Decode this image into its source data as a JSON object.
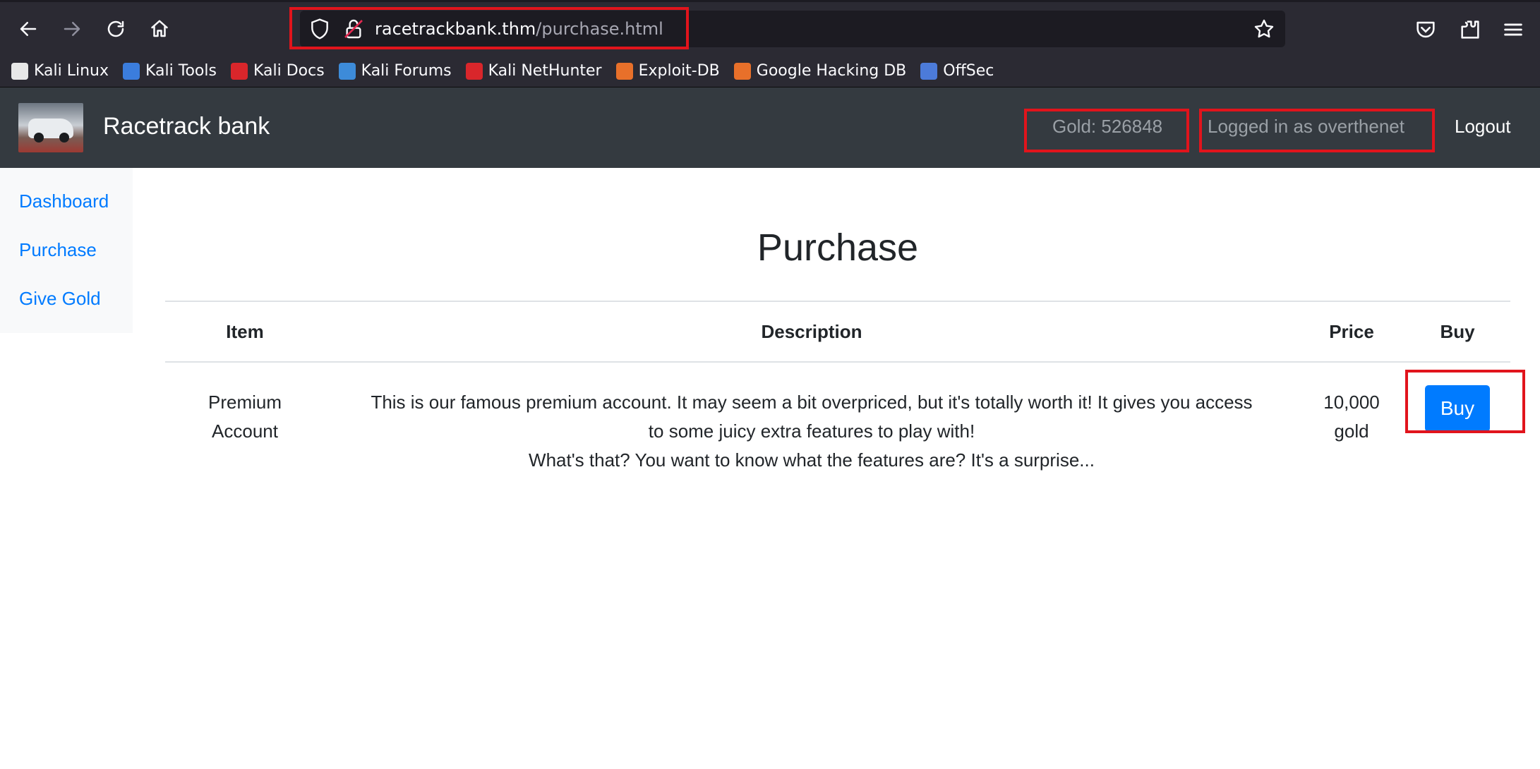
{
  "browser": {
    "url_host": "racetrackbank.thm",
    "url_path": "/purchase.html",
    "bookmarks": [
      {
        "label": "Kali Linux",
        "icon": "kali-dragon-icon",
        "color": "#e8e8e8"
      },
      {
        "label": "Kali Tools",
        "icon": "kali-tools-icon",
        "color": "#3b7ddd"
      },
      {
        "label": "Kali Docs",
        "icon": "kali-docs-icon",
        "color": "#d9262b"
      },
      {
        "label": "Kali Forums",
        "icon": "kali-forums-icon",
        "color": "#3d8bd9"
      },
      {
        "label": "Kali NetHunter",
        "icon": "kali-nethunter-icon",
        "color": "#d9262b"
      },
      {
        "label": "Exploit-DB",
        "icon": "exploit-db-icon",
        "color": "#e8702a"
      },
      {
        "label": "Google Hacking DB",
        "icon": "ghdb-icon",
        "color": "#e8702a"
      },
      {
        "label": "OffSec",
        "icon": "offsec-icon",
        "color": "#4c7bd9"
      }
    ]
  },
  "header": {
    "brand": "Racetrack bank",
    "gold": "Gold: 526848",
    "login": "Logged in as overthenet",
    "logout": "Logout"
  },
  "sidebar": {
    "items": [
      {
        "label": "Dashboard"
      },
      {
        "label": "Purchase"
      },
      {
        "label": "Give Gold"
      }
    ]
  },
  "main": {
    "title": "Purchase",
    "table": {
      "headers": [
        "Item",
        "Description",
        "Price",
        "Buy"
      ],
      "rows": [
        {
          "item_line1": "Premium",
          "item_line2": "Account",
          "desc_line1": "This is our famous premium account. It may seem a bit overpriced, but it's totally worth it! It gives you access",
          "desc_line2": "to some juicy extra features to play with!",
          "desc_line3": "What's that? You want to know what the features are? It's a surprise...",
          "price_line1": "10,000",
          "price_line2": "gold",
          "buy_label": "Buy"
        }
      ]
    }
  },
  "colors": {
    "highlight": "#e1141c",
    "accent": "#007bff",
    "navbar": "#343a40"
  }
}
